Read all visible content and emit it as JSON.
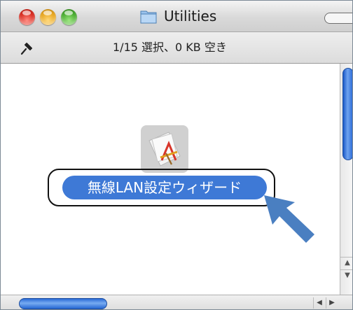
{
  "window": {
    "title": "Utilities",
    "folder_icon": "folder-icon"
  },
  "status": {
    "text": "1/15 選択、0 KB 空き",
    "pin_icon": "pin-icon"
  },
  "file": {
    "label": "無線LAN設定ウィザード",
    "icon": "application-icon"
  },
  "colors": {
    "selection": "#3e79d6",
    "scroll_thumb": "#2a6ad6",
    "arrow": "#4a7fc1"
  }
}
